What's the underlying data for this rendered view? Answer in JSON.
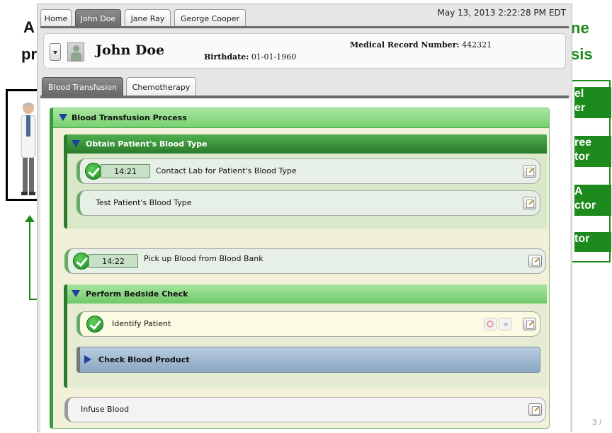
{
  "slide": {
    "head_left_1": "A",
    "head_left_2": "pr",
    "head_right_1": "ne",
    "head_right_2": "sis",
    "right_panel_items": [
      "el\ner",
      "ree\ntor",
      "A\nctor",
      "tor"
    ],
    "page_number": "3 /"
  },
  "tabs": {
    "patient_tabs": [
      {
        "label": "Home",
        "active": false
      },
      {
        "label": "John Doe",
        "active": true
      },
      {
        "label": "Jane Ray",
        "active": false
      },
      {
        "label": "George Cooper",
        "active": false
      }
    ],
    "timestamp": "May 13, 2013 2:22:28 PM EDT"
  },
  "patient": {
    "name": "John Doe",
    "birthdate_label": "Birthdate:",
    "birthdate": "01-01-1960",
    "mrn_label": "Medical Record Number:",
    "mrn": "442321"
  },
  "sub_tabs": [
    {
      "label": "Blood Transfusion",
      "active": true
    },
    {
      "label": "Chemotherapy",
      "active": false
    }
  ],
  "process": {
    "title": "Blood Transfusion Process",
    "group1": {
      "title": "Obtain Patient's Blood Type",
      "tasks": [
        {
          "label": "Contact Lab for Patient's Blood Type",
          "time": "14:21",
          "done": true
        },
        {
          "label": "Test Patient's Blood Type",
          "time": "",
          "done": false
        }
      ]
    },
    "task_pickup": {
      "label": "Pick up Blood from Blood Bank",
      "time": "14:22",
      "done": true
    },
    "group2": {
      "title": "Perform Bedside Check",
      "task": {
        "label": "Identify Patient",
        "done": true
      },
      "subgroup": {
        "title": "Check Blood Product"
      }
    },
    "task_infuse": {
      "label": "Infuse Blood",
      "done": false
    }
  },
  "icons": {
    "check": "check-circle-icon",
    "edit": "edit-note-icon",
    "expand": "triangle-down-icon",
    "collapse": "triangle-right-icon",
    "cancel": "no-entry-icon"
  },
  "colors": {
    "green_header": "#78d070",
    "dark_green": "#2a7a2a",
    "panel_bg": "#f2f0d8",
    "blue_triangle": "#1f3f9f"
  }
}
